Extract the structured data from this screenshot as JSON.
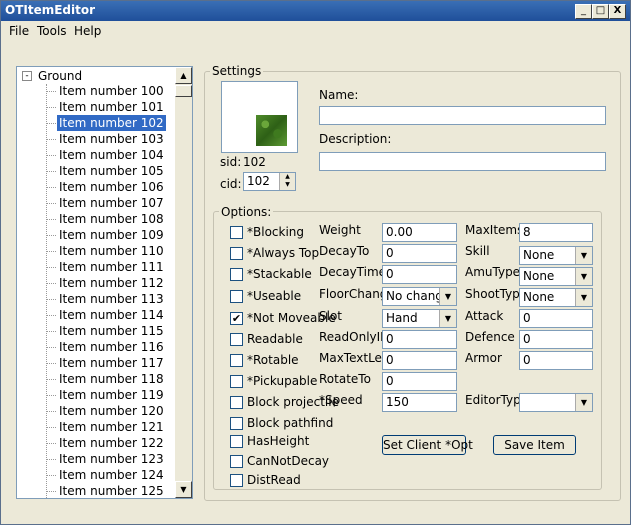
{
  "window": {
    "title": "OTItemEditor",
    "minimize": "_",
    "maximize": "□",
    "close": "X"
  },
  "menu": {
    "file": "File",
    "tools": "Tools",
    "help": "Help"
  },
  "tree": {
    "root_label": "Ground",
    "expander": "-",
    "items": [
      "Item number 100",
      "Item number 101",
      "Item number 102",
      "Item number 103",
      "Item number 104",
      "Item number 105",
      "Item number 106",
      "Item number 107",
      "Item number 108",
      "Item number 109",
      "Item number 110",
      "Item number 111",
      "Item number 112",
      "Item number 113",
      "Item number 114",
      "Item number 115",
      "Item number 116",
      "Item number 117",
      "Item number 118",
      "Item number 119",
      "Item number 120",
      "Item number 121",
      "Item number 122",
      "Item number 123",
      "Item number 124",
      "Item number 125"
    ],
    "selected_index": 2
  },
  "settings": {
    "legend": "Settings",
    "sid_label": "sid:",
    "sid_value": "102",
    "cid_label": "cid:",
    "cid_value": "102",
    "name_label": "Name:",
    "name_value": "",
    "description_label": "Description:",
    "description_value": ""
  },
  "options": {
    "legend": "Options:",
    "checkboxes": [
      {
        "label": "*Blocking",
        "checked": false
      },
      {
        "label": "*Always Top",
        "checked": false
      },
      {
        "label": "*Stackable",
        "checked": false
      },
      {
        "label": "*Useable",
        "checked": false
      },
      {
        "label": "*Not Moveable",
        "checked": true
      },
      {
        "label": "Readable",
        "checked": false
      },
      {
        "label": "*Rotable",
        "checked": false
      },
      {
        "label": "*Pickupable",
        "checked": false
      },
      {
        "label": "Block projectile",
        "checked": false
      },
      {
        "label": "Block pathfind",
        "checked": false
      },
      {
        "label": "HasHeight",
        "checked": false
      },
      {
        "label": "CanNotDecay",
        "checked": false
      },
      {
        "label": "DistRead",
        "checked": false
      }
    ],
    "weight_label": "Weight",
    "weight_value": "0.00",
    "decayto_label": "DecayTo",
    "decayto_value": "0",
    "decaytime_label": "DecayTime",
    "decaytime_value": "0",
    "floorchange_label": "FloorChange",
    "floorchange_value": "No change",
    "slot_label": "Slot",
    "slot_value": "Hand",
    "readonlyid_label": "ReadOnlyID",
    "readonlyid_value": "0",
    "maxtextlen_label": "MaxTextLen",
    "maxtextlen_value": "0",
    "rotateto_label": "RotateTo",
    "rotateto_value": "0",
    "speed_label": "*Speed",
    "speed_value": "150",
    "maxitems_label": "MaxItems",
    "maxitems_value": "8",
    "skill_label": "Skill",
    "skill_value": "None",
    "amutype_label": "AmuType",
    "amutype_value": "None",
    "shoottype_label": "ShootType",
    "shoottype_value": "None",
    "attack_label": "Attack",
    "attack_value": "0",
    "defence_label": "Defence",
    "defence_value": "0",
    "armor_label": "Armor",
    "armor_value": "0",
    "editortype_label": "EditorType",
    "editortype_value": ""
  },
  "buttons": {
    "set_client": "Set Client *Opt",
    "save_item": "Save Item"
  }
}
